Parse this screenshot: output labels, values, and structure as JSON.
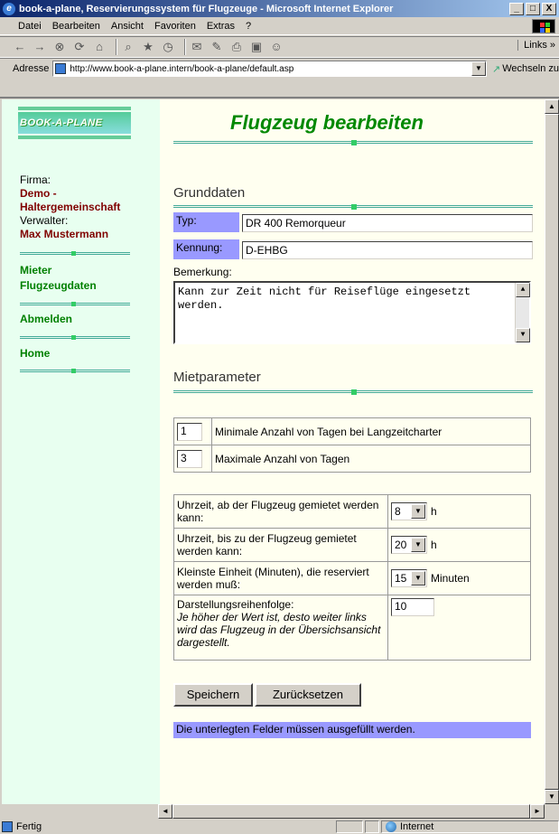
{
  "window": {
    "title": "book-a-plane, Reservierungssystem für Flugzeuge - Microsoft Internet Explorer",
    "min": "_",
    "max": "□",
    "close": "X"
  },
  "menu": {
    "items": [
      "Datei",
      "Bearbeiten",
      "Ansicht",
      "Favoriten",
      "Extras",
      "?"
    ]
  },
  "toolbar": {
    "links": "Links »"
  },
  "address": {
    "label": "Adresse",
    "url": "http://www.book-a-plane.intern/book-a-plane/default.asp",
    "go": "Wechseln zu"
  },
  "sidebar": {
    "logo": "BOOK-A-PLANE",
    "firma_label": "Firma:",
    "firma_value_1": "Demo -",
    "firma_value_2": "Haltergemeinschaft",
    "verwalter_label": "Verwalter:",
    "verwalter_value": "Max Mustermann",
    "links": [
      "Mieter",
      "Flugzeugdaten",
      "Abmelden",
      "Home"
    ]
  },
  "main": {
    "title": "Flugzeug bearbeiten",
    "grunddaten": {
      "heading": "Grunddaten",
      "typ_label": "Typ:",
      "typ_value": "DR 400 Remorqueur",
      "kennung_label": "Kennung:",
      "kennung_value": "D-EHBG",
      "bemerkung_label": "Bemerkung:",
      "bemerkung_value_1": "Kann zur Zeit nicht für Reiseflüge eingesetzt",
      "bemerkung_value_2": "werden."
    },
    "mietparameter": {
      "heading": "Mietparameter",
      "min_tage_value": "1",
      "min_tage_label": "Minimale Anzahl von Tagen bei Langzeitcharter",
      "max_tage_value": "3",
      "max_tage_label": "Maximale Anzahl von Tagen"
    },
    "zeiten": {
      "ab_label": "Uhrzeit, ab der Flugzeug gemietet werden kann:",
      "ab_value": "8",
      "ab_unit": "h",
      "bis_label": "Uhrzeit, bis zu der Flugzeug gemietet werden kann:",
      "bis_value": "20",
      "bis_unit": "h",
      "einheit_label": "Kleinste Einheit (Minuten), die reserviert werden muß:",
      "einheit_value": "15",
      "einheit_unit": "Minuten",
      "reihenfolge_label": "Darstellungsreihenfolge:",
      "reihenfolge_hint": "Je höher der Wert ist, desto weiter links wird das Flugzeug in der Übersichsansicht dargestellt.",
      "reihenfolge_value": "10"
    },
    "buttons": {
      "save": "Speichern",
      "reset": "Zurücksetzen"
    },
    "note": "Die unterlegten Felder müssen ausgefüllt werden."
  },
  "status": {
    "text": "Fertig",
    "zone": "Internet"
  }
}
